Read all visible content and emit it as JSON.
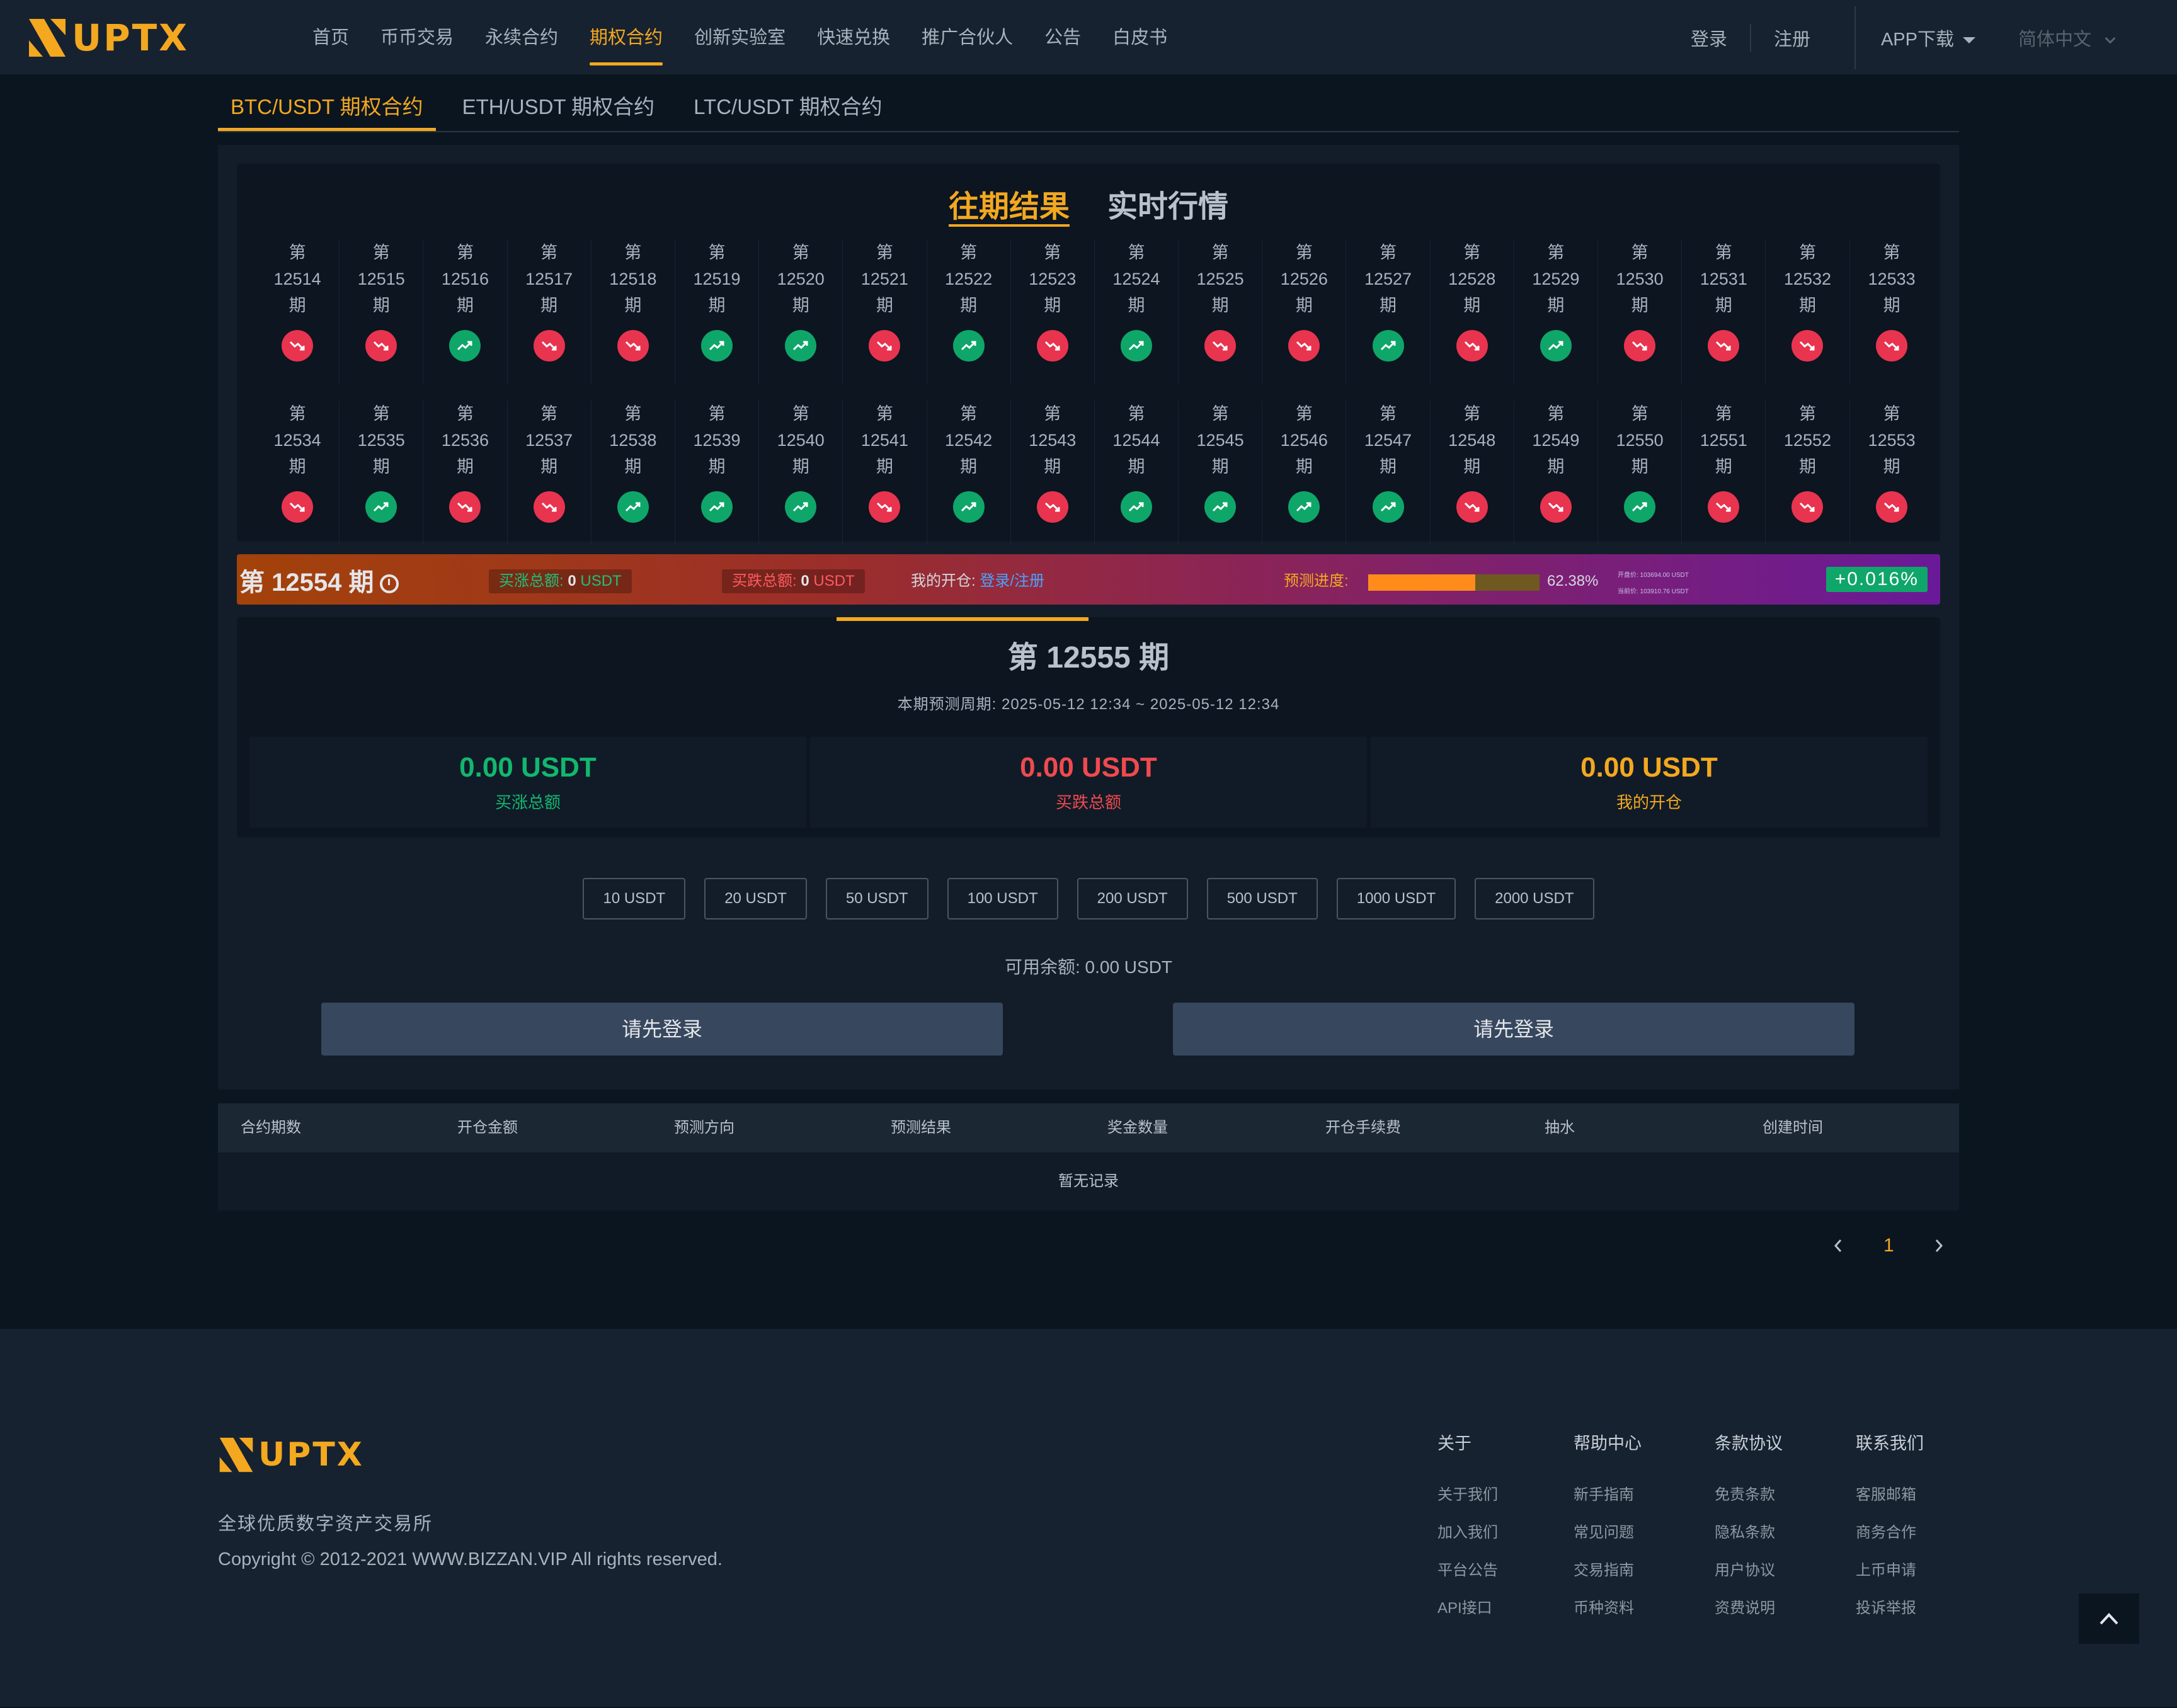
{
  "header": {
    "logo_text": "UPTX",
    "nav": [
      {
        "label": "首页",
        "active": false
      },
      {
        "label": "币币交易",
        "active": false
      },
      {
        "label": "永续合约",
        "active": false
      },
      {
        "label": "期权合约",
        "active": true
      },
      {
        "label": "创新实验室",
        "active": false
      },
      {
        "label": "快速兑换",
        "active": false
      },
      {
        "label": "推广合伙人",
        "active": false
      },
      {
        "label": "公告",
        "active": false
      },
      {
        "label": "白皮书",
        "active": false
      }
    ],
    "login": "登录",
    "register": "注册",
    "app_download": "APP下载",
    "language": "简体中文"
  },
  "pair_tabs": [
    {
      "label": "BTC/USDT 期权合约",
      "active": true
    },
    {
      "label": "ETH/USDT 期权合约",
      "active": false
    },
    {
      "label": "LTC/USDT 期权合约",
      "active": false
    }
  ],
  "results": {
    "tabs": [
      {
        "label": "往期结果",
        "active": true
      },
      {
        "label": "实时行情",
        "active": false
      }
    ],
    "prefix": "第",
    "suffix": "期",
    "rows": [
      [
        {
          "period": "12514",
          "direction": "down"
        },
        {
          "period": "12515",
          "direction": "down"
        },
        {
          "period": "12516",
          "direction": "up"
        },
        {
          "period": "12517",
          "direction": "down"
        },
        {
          "period": "12518",
          "direction": "down"
        },
        {
          "period": "12519",
          "direction": "up"
        },
        {
          "period": "12520",
          "direction": "up"
        },
        {
          "period": "12521",
          "direction": "down"
        },
        {
          "period": "12522",
          "direction": "up"
        },
        {
          "period": "12523",
          "direction": "down"
        },
        {
          "period": "12524",
          "direction": "up"
        },
        {
          "period": "12525",
          "direction": "down"
        },
        {
          "period": "12526",
          "direction": "down"
        },
        {
          "period": "12527",
          "direction": "up"
        },
        {
          "period": "12528",
          "direction": "down"
        },
        {
          "period": "12529",
          "direction": "up"
        },
        {
          "period": "12530",
          "direction": "down"
        },
        {
          "period": "12531",
          "direction": "down"
        },
        {
          "period": "12532",
          "direction": "down"
        },
        {
          "period": "12533",
          "direction": "down"
        }
      ],
      [
        {
          "period": "12534",
          "direction": "down"
        },
        {
          "period": "12535",
          "direction": "up"
        },
        {
          "period": "12536",
          "direction": "down"
        },
        {
          "period": "12537",
          "direction": "down"
        },
        {
          "period": "12538",
          "direction": "up"
        },
        {
          "period": "12539",
          "direction": "up"
        },
        {
          "period": "12540",
          "direction": "up"
        },
        {
          "period": "12541",
          "direction": "down"
        },
        {
          "period": "12542",
          "direction": "up"
        },
        {
          "period": "12543",
          "direction": "down"
        },
        {
          "period": "12544",
          "direction": "up"
        },
        {
          "period": "12545",
          "direction": "up"
        },
        {
          "period": "12546",
          "direction": "up"
        },
        {
          "period": "12547",
          "direction": "up"
        },
        {
          "period": "12548",
          "direction": "down"
        },
        {
          "period": "12549",
          "direction": "down"
        },
        {
          "period": "12550",
          "direction": "up"
        },
        {
          "period": "12551",
          "direction": "down"
        },
        {
          "period": "12552",
          "direction": "down"
        },
        {
          "period": "12553",
          "direction": "down"
        }
      ]
    ]
  },
  "current": {
    "title": "第 12554 期",
    "buy_up_label": "买涨总额: ",
    "buy_up_value": "0",
    "buy_down_label": "买跌总额: ",
    "buy_down_value": "0",
    "unit": " USDT",
    "my_open_label": "我的开仓: ",
    "my_open_link": "登录/注册",
    "progress_label": "预测进度:",
    "progress_value": 0.6238,
    "progress_text": "62.38%",
    "open_price": "开盘价: 103694.00 USDT",
    "current_price": "当前价: 103910.76 USDT",
    "change": "+0.016%"
  },
  "next": {
    "title": "第 12555 期",
    "time_range": "本期预测周期: 2025-05-12 12:34 ~ 2025-05-12 12:34",
    "stats": [
      {
        "value": "0.00 USDT",
        "label": "买涨总额"
      },
      {
        "value": "0.00 USDT",
        "label": "买跌总额"
      },
      {
        "value": "0.00 USDT",
        "label": "我的开仓"
      }
    ]
  },
  "amounts": [
    "10 USDT",
    "20 USDT",
    "50 USDT",
    "100 USDT",
    "200 USDT",
    "500 USDT",
    "1000 USDT",
    "2000 USDT"
  ],
  "balance": "可用余额: 0.00 USDT",
  "login_buttons": [
    "请先登录",
    "请先登录"
  ],
  "table": {
    "columns": [
      "合约期数",
      "开仓金额",
      "预测方向",
      "预测结果",
      "奖金数量",
      "开仓手续费",
      "抽水",
      "创建时间"
    ],
    "empty": "暂无记录"
  },
  "pagination": {
    "current": "1"
  },
  "footer": {
    "logo_text": "UPTX",
    "slogan": "全球优质数字资产交易所",
    "copyright": "Copyright © 2012-2021 WWW.BIZZAN.VIP All rights reserved.",
    "columns": [
      {
        "title": "关于",
        "items": [
          "关于我们",
          "加入我们",
          "平台公告",
          "API接口"
        ]
      },
      {
        "title": "帮助中心",
        "items": [
          "新手指南",
          "常见问题",
          "交易指南",
          "币种资料"
        ]
      },
      {
        "title": "条款协议",
        "items": [
          "免责条款",
          "隐私条款",
          "用户协议",
          "资费说明"
        ]
      },
      {
        "title": "联系我们",
        "items": [
          "客服邮箱",
          "商务合作",
          "上币申请",
          "投诉举报"
        ]
      }
    ]
  },
  "colors": {
    "accent": "#f3a820",
    "up": "#0fa66a",
    "down": "#e8344f"
  }
}
